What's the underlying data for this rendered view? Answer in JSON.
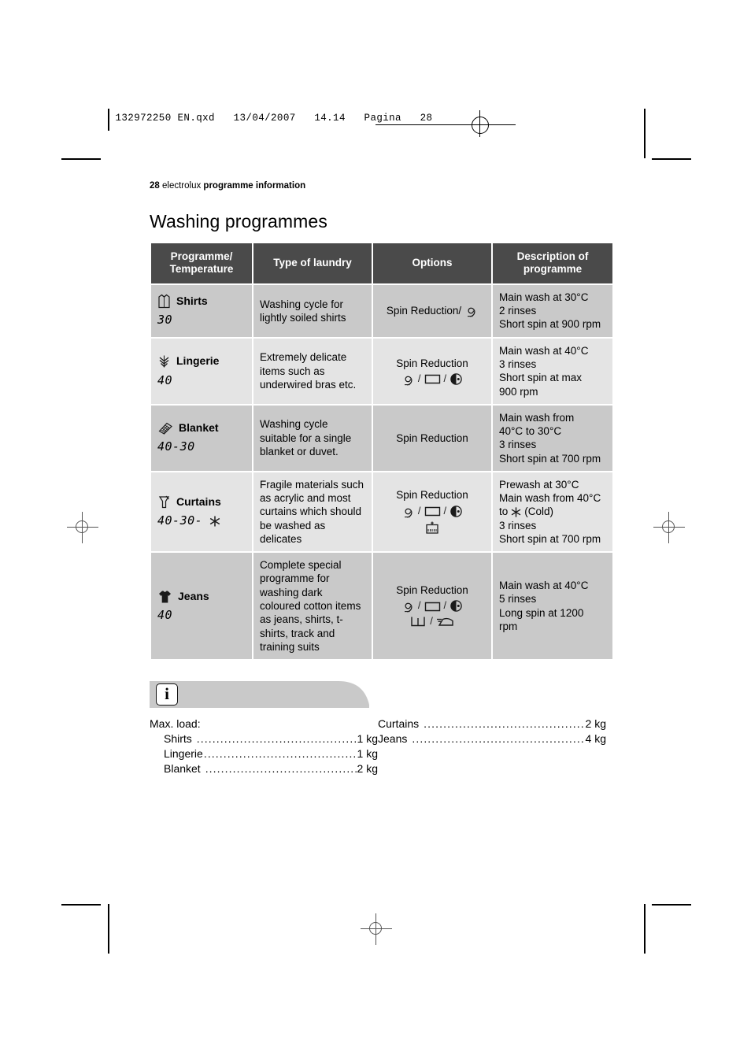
{
  "printmark": {
    "filename_line": "132972250 EN.qxd   13/04/2007   14.14   Pagina   28"
  },
  "running_head": {
    "page_number": "28",
    "brand": "electrolux",
    "section": "programme information"
  },
  "title": "Washing programmes",
  "table": {
    "headers": [
      "Programme/\nTemperature",
      "Type of laundry",
      "Options",
      "Description of\nprogramme"
    ],
    "headers_flat": {
      "col1_line1": "Programme/",
      "col1_line2": "Temperature",
      "col2": "Type of laundry",
      "col3": "Options",
      "col4_line1": "Description of",
      "col4_line2": "programme"
    },
    "rows": [
      {
        "programme": "Shirts",
        "icon": "shirt-icon",
        "temperature": "30",
        "temperature_extra_icon": "",
        "type_of_laundry": "Washing cycle for lightly soiled shirts",
        "options_label": "Spin Reduction/",
        "options_icons_row1": [
          "spin-reduction-icon"
        ],
        "options_icons_row2": [],
        "options_inline": true,
        "description": "Main wash at 30°C\n2 rinses\nShort spin at 900 rpm",
        "description_lines": [
          "Main wash at 30°C",
          "2 rinses",
          "Short spin at 900 rpm"
        ]
      },
      {
        "programme": "Lingerie",
        "icon": "lingerie-icon",
        "temperature": "40",
        "temperature_extra_icon": "",
        "type_of_laundry": "Extremely delicate items such as underwired bras etc.",
        "options_label": "Spin Reduction",
        "options_icons_row1": [
          "spin-reduction-icon",
          "rinse-hold-icon",
          "delay-start-icon"
        ],
        "options_icons_row2": [],
        "options_inline": false,
        "description": "Main wash at 40°C\n3 rinses\nShort spin at max 900 rpm",
        "description_lines": [
          "Main wash at 40°C",
          "3 rinses",
          "Short spin at max",
          "900 rpm"
        ]
      },
      {
        "programme": "Blanket",
        "icon": "blanket-icon",
        "temperature": "40-30",
        "temperature_extra_icon": "",
        "type_of_laundry": "Washing cycle suitable for a single blanket or duvet.",
        "options_label": "Spin Reduction",
        "options_icons_row1": [],
        "options_icons_row2": [],
        "options_inline": false,
        "description": "Main wash from 40°C to 30°C\n3 rinses\nShort spin at 700 rpm",
        "description_lines": [
          "Main wash from",
          "40°C to 30°C",
          "3 rinses",
          "Short spin at 700 rpm"
        ]
      },
      {
        "programme": "Curtains",
        "icon": "curtains-icon",
        "temperature": "40-30-",
        "temperature_extra_icon": "cold-icon",
        "type_of_laundry": "Fragile materials such as acrylic and most curtains which should be washed as delicates",
        "options_label": "Spin Reduction",
        "options_icons_row1": [
          "spin-reduction-icon",
          "rinse-hold-icon",
          "delay-start-icon"
        ],
        "options_icons_row2": [
          "prewash-icon"
        ],
        "options_inline": false,
        "description": "Prewash at 30°C\nMain wash from 40°C to (Cold)\n3 rinses\nShort spin at 700 rpm",
        "description_lines": [
          "Prewash at 30°C",
          "Main wash from 40°C",
          "to  (Cold)",
          "3 rinses",
          "Short spin at 700 rpm"
        ],
        "description_cold_line_prefix": "to ",
        "description_cold_line_suffix": " (Cold)"
      },
      {
        "programme": "Jeans",
        "icon": "tshirt-icon",
        "temperature": "40",
        "temperature_extra_icon": "",
        "type_of_laundry": "Complete special programme for washing dark coloured cotton items as jeans, shirts, t-shirts, track and training suits",
        "options_label": "Spin Reduction",
        "options_icons_row1": [
          "spin-reduction-icon",
          "rinse-hold-icon",
          "delay-start-icon"
        ],
        "options_icons_row2": [
          "extra-rinse-icon",
          "easy-iron-icon"
        ],
        "options_inline": false,
        "description": "Main wash at 40°C\n5 rinses\nLong spin at 1200 rpm",
        "description_lines": [
          "Main wash at 40°C",
          "5 rinses",
          "Long spin at 1200",
          "rpm"
        ]
      }
    ]
  },
  "info": {
    "icon": "info-icon",
    "icon_glyph": "i",
    "max_load_title": "Max. load:",
    "left_column": [
      {
        "name": "Shirts",
        "value": "1 kg"
      },
      {
        "name": "Lingerie",
        "value": "1 kg"
      },
      {
        "name": "Blanket",
        "value": "2 kg"
      }
    ],
    "right_column": [
      {
        "name": "Curtains",
        "value": "2 kg"
      },
      {
        "name": "Jeans",
        "value": "4 kg"
      }
    ]
  },
  "colors": {
    "header_bg": "#4a4a4a",
    "row_shade_a": "#c9c9c9",
    "row_shade_b": "#e4e4e4",
    "info_banner": "#c9c9c9",
    "text": "#000000"
  }
}
